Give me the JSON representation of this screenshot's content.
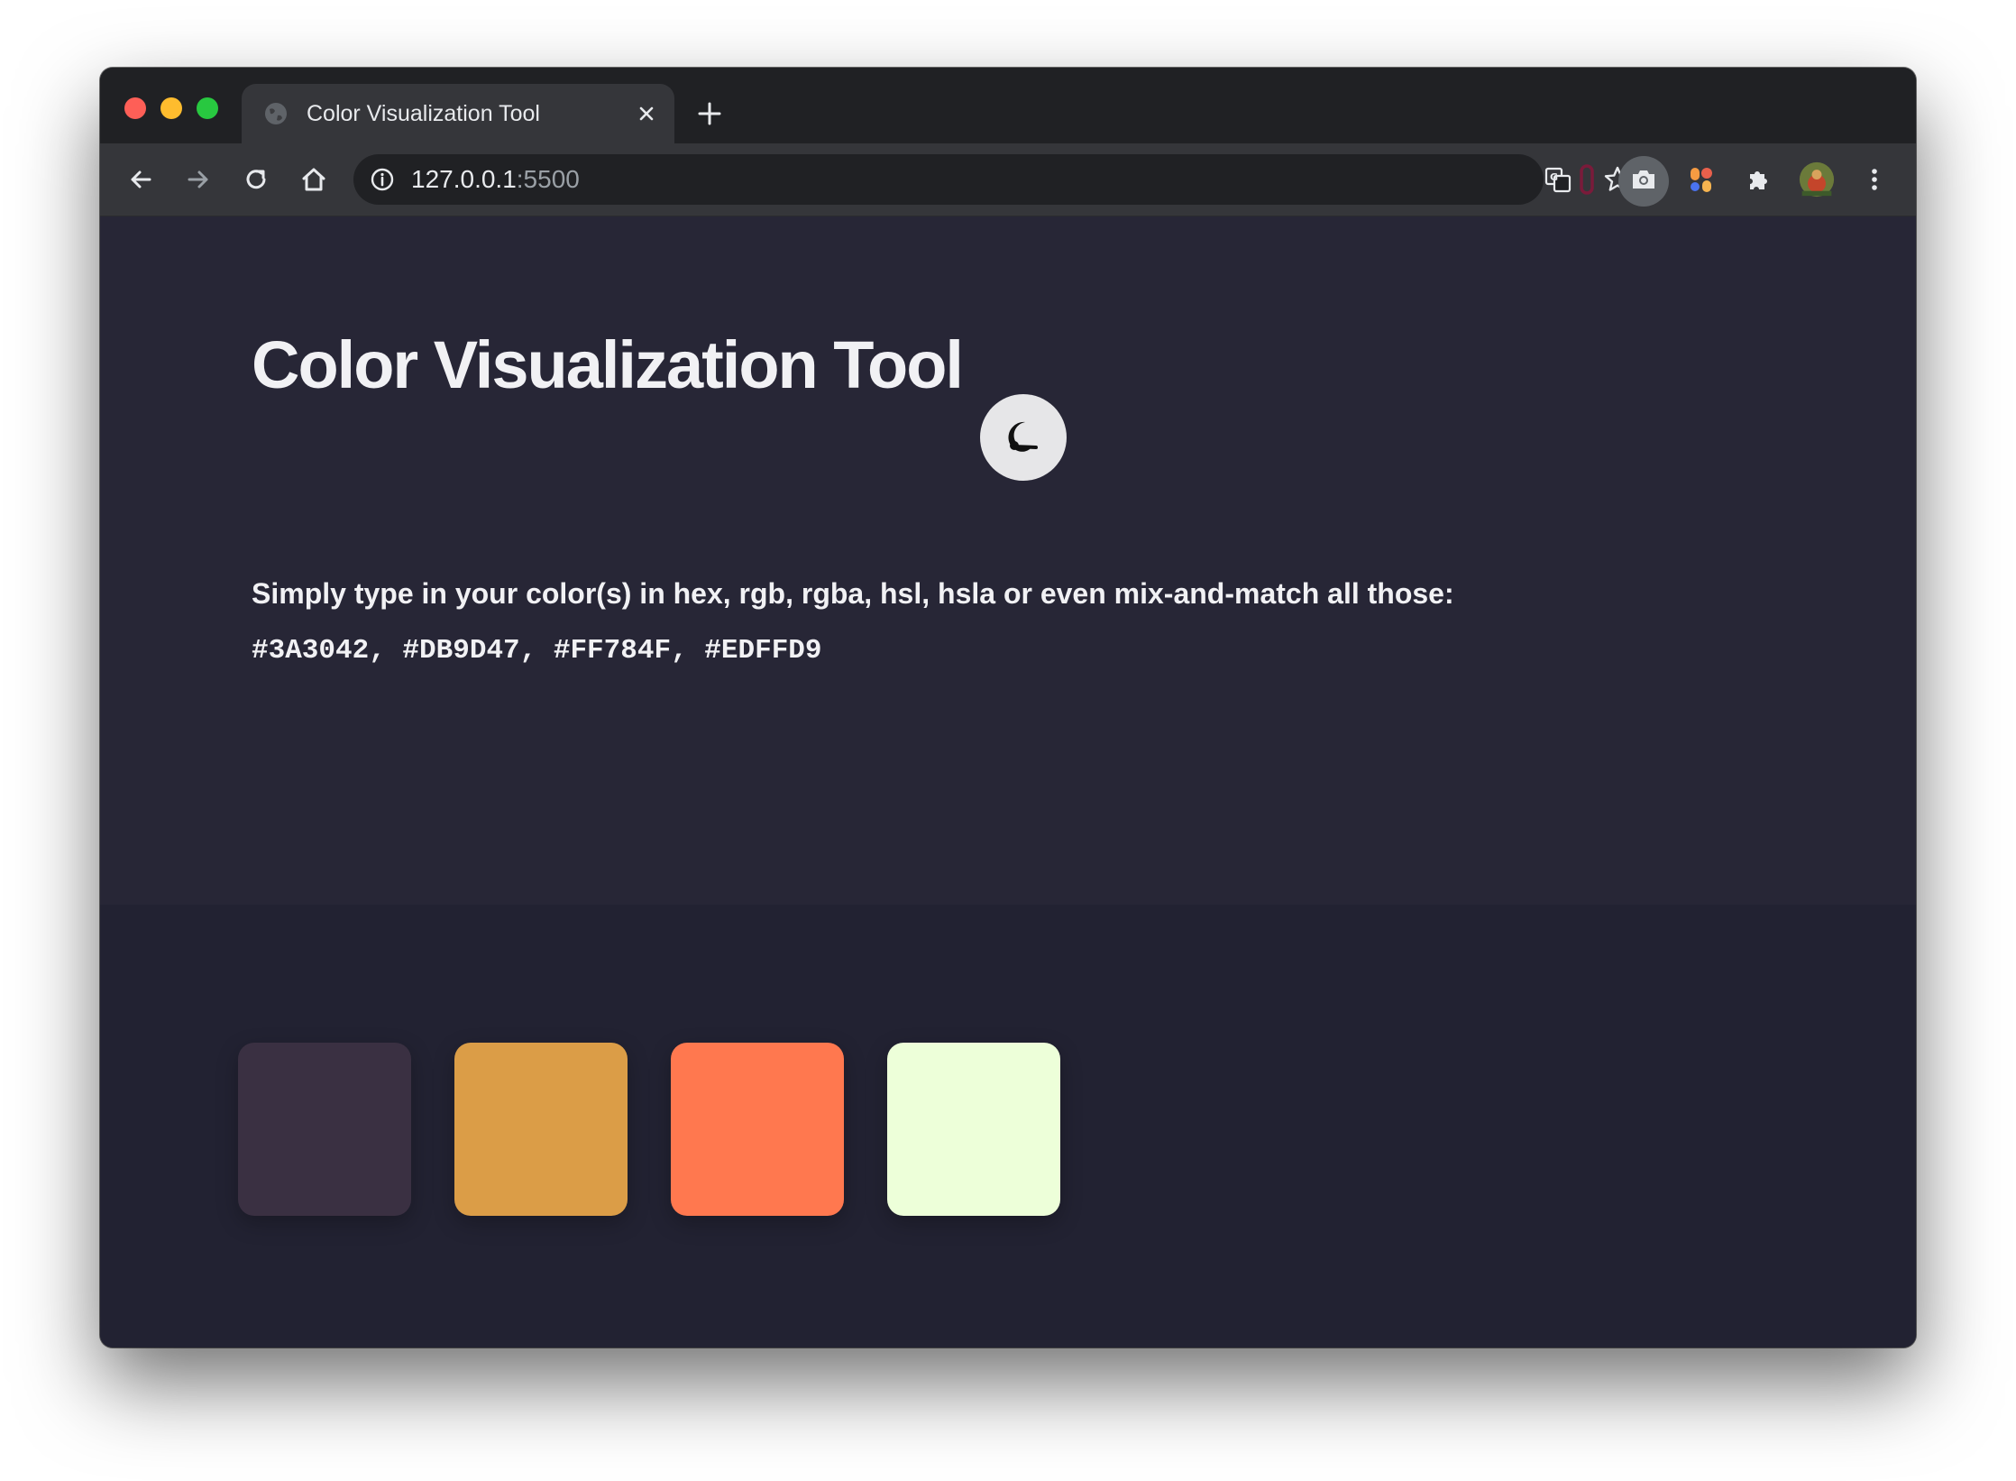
{
  "browser": {
    "tab_title": "Color Visualization Tool",
    "url_host": "127.0.0.1",
    "url_port": ":5500",
    "icons": {
      "back": "arrow-left-icon",
      "forward": "arrow-right-icon",
      "reload": "reload-icon",
      "home": "home-icon",
      "info": "info-icon",
      "translate": "translate-icon",
      "bookmark": "star-icon",
      "extensions": "puzzle-icon",
      "menu": "kebab-menu-icon"
    }
  },
  "page": {
    "title": "Color Visualization Tool",
    "theme_toggle_icon": "moon-icon",
    "instruction": "Simply type in your color(s) in hex, rgb, rgba, hsl, hsla or even mix-and-match all those:",
    "input_value": "#3A3042, #DB9D47, #FF784F, #EDFFD9",
    "swatches": [
      {
        "color": "#3A3042"
      },
      {
        "color": "#DB9D47"
      },
      {
        "color": "#FF784F"
      },
      {
        "color": "#EDFFD9"
      }
    ]
  },
  "colors": {
    "page_background": "#272636",
    "swatch_section_background": "#222232",
    "text": "#f1f1f4"
  }
}
